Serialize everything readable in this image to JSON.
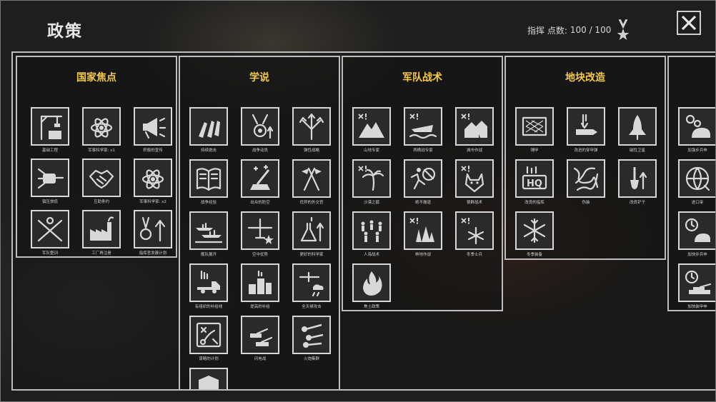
{
  "header": {
    "title": "政策",
    "points_label": "指挥 点数:",
    "points_value": "100 / 100"
  },
  "colors": {
    "accent_title": "#f2c94c",
    "border": "#bdbdbd",
    "icon": "#d8d8d8"
  },
  "columns": [
    {
      "title": "国家焦点",
      "cards": [
        {
          "label": "基础工程",
          "icon": "crane-factory-icon"
        },
        {
          "label": "军事科学家: x1",
          "icon": "atom-x1-icon"
        },
        {
          "label": "积极的宣传",
          "icon": "megaphone-icon"
        },
        {
          "label": "镇压放低",
          "icon": "fist-hammer-icon"
        },
        {
          "label": "互助条约",
          "icon": "handshake-icon"
        },
        {
          "label": "军事科学家: x2",
          "icon": "atom-x2-icon"
        },
        {
          "label": "军队整训",
          "icon": "crossed-rifles-icon"
        },
        {
          "label": "工厂再注册",
          "icon": "factory-icon"
        },
        {
          "label": "指挥官发展计划",
          "icon": "medal-arrow-icon"
        }
      ]
    },
    {
      "title": "学说",
      "cards": [
        {
          "label": "持续炮击",
          "icon": "shells-icon"
        },
        {
          "label": "战争动员",
          "icon": "medal-gear-icon"
        },
        {
          "label": "弹性战略",
          "icon": "split-arrows-icon"
        },
        {
          "label": "战争经验",
          "icon": "open-book-icon"
        },
        {
          "label": "出众的防空",
          "icon": "anti-air-gun-icon"
        },
        {
          "label": "优异的外交官",
          "icon": "flags-icon"
        },
        {
          "label": "舰队展开",
          "icon": "battleships-icon"
        },
        {
          "label": "空中优势",
          "icon": "plane-star-icon"
        },
        {
          "label": "更好的科学家",
          "icon": "flask-arrows-icon"
        },
        {
          "label": "有组织的补给线",
          "icon": "supply-truck-icon"
        },
        {
          "label": "提高的补给",
          "icon": "supply-crates-icon"
        },
        {
          "label": "全天候攻击",
          "icon": "plane-rain-icon"
        },
        {
          "label": "谋略的计划",
          "icon": "tactics-map-icon"
        },
        {
          "label": "闪电战",
          "icon": "tanks-icon"
        },
        {
          "label": "火炮集群",
          "icon": "artillery-group-icon"
        },
        {
          "label": "",
          "icon": "shield-icon"
        }
      ]
    },
    {
      "title": "军队战术",
      "cards": [
        {
          "label": "山地专家",
          "icon": "mountain-icon"
        },
        {
          "label": "两栖战专家",
          "icon": "amphibious-icon"
        },
        {
          "label": "城市作战",
          "icon": "houses-icon"
        },
        {
          "label": "沙漠之狐",
          "icon": "palm-tree-icon"
        },
        {
          "label": "绝不撤退",
          "icon": "no-retreat-icon"
        },
        {
          "label": "狼群战术",
          "icon": "wolf-icon"
        },
        {
          "label": "人海战术",
          "icon": "crowd-icon"
        },
        {
          "label": "林地作战",
          "icon": "pine-trees-icon"
        },
        {
          "label": "冬季士兵",
          "icon": "snowflake-soldier-icon"
        },
        {
          "label": "焦土政策",
          "icon": "fire-icon"
        }
      ]
    },
    {
      "title": "地块改造",
      "cards": [
        {
          "label": "铺甲",
          "icon": "plating-icon"
        },
        {
          "label": "改进的穿甲弹",
          "icon": "ap-shell-icon"
        },
        {
          "label": "磁性卫星",
          "icon": "rocket-icon"
        },
        {
          "label": "改良的指挥",
          "icon": "hq-icon"
        },
        {
          "label": "伪装",
          "icon": "camouflage-icon"
        },
        {
          "label": "改良铲子",
          "icon": "shovel-icon"
        },
        {
          "label": "冬季装备",
          "icon": "snowflake-icon"
        }
      ]
    },
    {
      "title": "",
      "cards": [
        {
          "label": "加强步兵申",
          "icon": "gears-helmet-icon"
        },
        {
          "label": "进口审",
          "icon": "globe-icon"
        },
        {
          "label": "加快步兵申",
          "icon": "clock-helmet-icon"
        },
        {
          "label": "加快装甲申",
          "icon": "clock-tank-icon"
        }
      ]
    }
  ]
}
